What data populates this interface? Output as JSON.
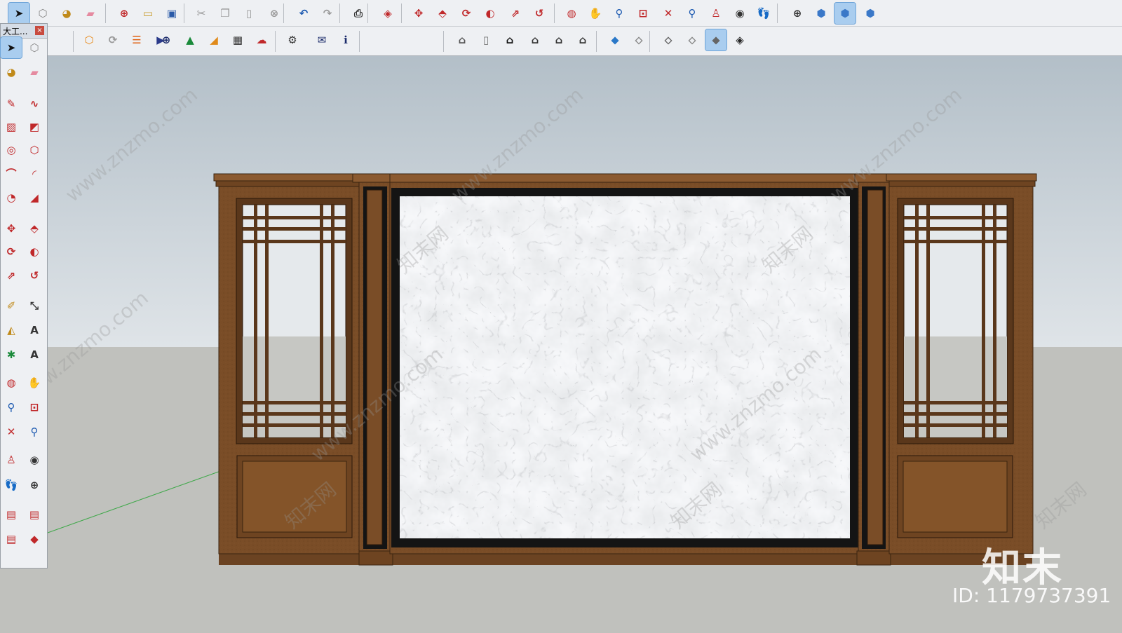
{
  "toolbar_top": {
    "icons": [
      "select-icon",
      "make-component-icon",
      "paint-bucket-icon",
      "eraser-icon",
      "model-info-icon",
      "open-icon",
      "save-icon",
      "cut-icon",
      "copy-icon",
      "paste-icon",
      "erase-icon",
      "undo-icon",
      "redo-icon",
      "print-icon",
      "user-info-icon",
      "move-icon",
      "push-pull-icon",
      "rotate-icon",
      "follow-me-icon",
      "scale-icon",
      "offset-icon",
      "orbit-icon",
      "pan-icon",
      "zoom-icon",
      "zoom-window-icon",
      "zoom-extents-icon",
      "previous-view-icon",
      "position-camera-icon",
      "look-around-icon",
      "walk-icon",
      "section-plane-icon",
      "xray-icon",
      "back-edges-icon",
      "wireframe-icon"
    ]
  },
  "toolbar_second": {
    "icons": [
      "extension-warehouse-icon",
      "refresh-icon",
      "layers-icon",
      "camera-icon",
      "add-location-icon",
      "trimble-icon",
      "sandbox-icon",
      "checker-icon",
      "cloud-upload-icon",
      "settings-icon",
      "mail-icon",
      "info-icon",
      "iso-view-icon",
      "top-view-icon",
      "front-view-icon",
      "right-view-icon",
      "back-view-icon",
      "left-view-icon",
      "xray-style-icon",
      "wireframe-style-icon",
      "hidden-line-icon",
      "shaded-icon",
      "shaded-textures-icon",
      "monochrome-icon"
    ]
  },
  "tray": {
    "title": "大工...",
    "close_label": "×"
  },
  "watermark": {
    "logo_text": "知末",
    "id_text": "ID: 1179737391",
    "diagonal_text": "www.znzmo.com",
    "site_cn": "知末网"
  },
  "colors": {
    "wood": "#7a4d27",
    "wood_dark": "#4a2d14",
    "frame_black": "#141414",
    "marble": "#e9ebee",
    "active_tool": "#a9cdef"
  }
}
